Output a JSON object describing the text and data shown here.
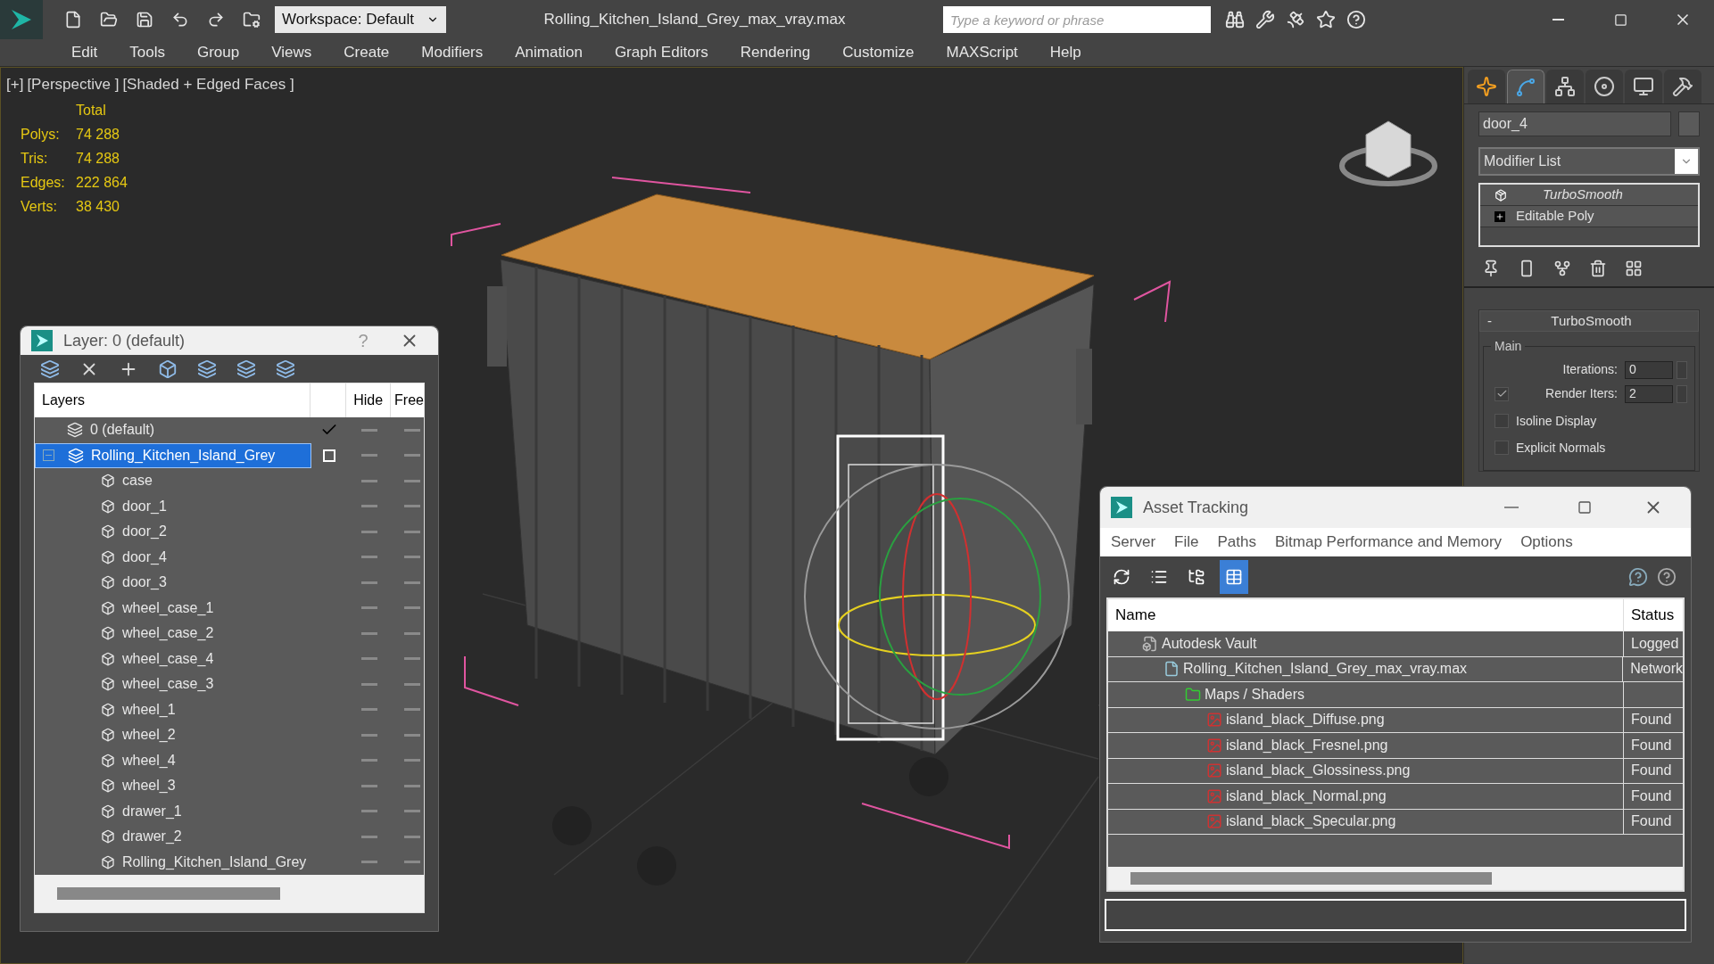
{
  "title_bar": {
    "title": "Rolling_Kitchen_Island_Grey_max_vray.max",
    "workspace": "Workspace: Default",
    "search": {
      "placeholder": "Type a keyword or phrase"
    }
  },
  "menu": [
    "Edit",
    "Tools",
    "Group",
    "Views",
    "Create",
    "Modifiers",
    "Animation",
    "Graph Editors",
    "Rendering",
    "Customize",
    "MAXScript",
    "Help"
  ],
  "viewport": {
    "labels": [
      "[+]",
      "[Perspective ]",
      "[Shaded + Edged Faces ]"
    ],
    "stats": {
      "header": "Total",
      "rows": [
        {
          "label": "Polys:",
          "value": "74 288"
        },
        {
          "label": "Tris:",
          "value": "74 288"
        },
        {
          "label": "Edges:",
          "value": "222 864"
        },
        {
          "label": "Verts:",
          "value": "38 430"
        }
      ]
    }
  },
  "layer_dialog": {
    "title": "Layer: 0 (default)",
    "help": "?",
    "columns": [
      "Layers",
      "Hide",
      "Free"
    ],
    "layers": [
      {
        "kind": "layer",
        "name": "0 (default)",
        "selected": false,
        "active": true
      },
      {
        "kind": "layer",
        "name": "Rolling_Kitchen_Island_Grey",
        "selected": true,
        "active": false,
        "expanded": true,
        "children": [
          {
            "kind": "object",
            "name": "case",
            "selected": false
          },
          {
            "kind": "object",
            "name": "door_1",
            "selected": false
          },
          {
            "kind": "object",
            "name": "door_2",
            "selected": false
          },
          {
            "kind": "object",
            "name": "door_4",
            "selected": false
          },
          {
            "kind": "object",
            "name": "door_3",
            "selected": false
          },
          {
            "kind": "object",
            "name": "wheel_case_1",
            "selected": false
          },
          {
            "kind": "object",
            "name": "wheel_case_2",
            "selected": false
          },
          {
            "kind": "object",
            "name": "wheel_case_4",
            "selected": false
          },
          {
            "kind": "object",
            "name": "wheel_case_3",
            "selected": false
          },
          {
            "kind": "object",
            "name": "wheel_1",
            "selected": false
          },
          {
            "kind": "object",
            "name": "wheel_2",
            "selected": false
          },
          {
            "kind": "object",
            "name": "wheel_4",
            "selected": false
          },
          {
            "kind": "object",
            "name": "wheel_3",
            "selected": false
          },
          {
            "kind": "object",
            "name": "drawer_1",
            "selected": false
          },
          {
            "kind": "object",
            "name": "drawer_2",
            "selected": false
          },
          {
            "kind": "object",
            "name": "Rolling_Kitchen_Island_Grey",
            "selected": false
          }
        ]
      }
    ]
  },
  "command_panel": {
    "tabs": [
      {
        "kind": "create",
        "selected": false
      },
      {
        "kind": "modify",
        "selected": true
      },
      {
        "kind": "hierarchy",
        "selected": false
      },
      {
        "kind": "motion",
        "selected": false
      },
      {
        "kind": "display",
        "selected": false
      },
      {
        "kind": "utilities",
        "selected": false
      }
    ],
    "object_name": "door_4",
    "modifier_list": "Modifier List",
    "stack": [
      {
        "kind": "modifier",
        "name": "TurboSmooth"
      },
      {
        "kind": "base",
        "name": "Editable Poly"
      }
    ],
    "rollout": {
      "title": "TurboSmooth",
      "collapse": "-",
      "group": "Main",
      "controls": [
        {
          "kind": "spinner",
          "label": "Iterations:",
          "value": "0"
        },
        {
          "kind": "check_spinner",
          "label": "Render Iters:",
          "value": "2",
          "checked": true
        },
        {
          "kind": "checkbox",
          "label": "Isoline Display",
          "checked": false
        },
        {
          "kind": "checkbox",
          "label": "Explicit Normals",
          "checked": false
        }
      ]
    }
  },
  "asset_tracking": {
    "title": "Asset Tracking",
    "menu": [
      "Server",
      "File",
      "Paths",
      "Bitmap Performance and Memory",
      "Options"
    ],
    "toolbar": [
      {
        "kind": "refresh",
        "selected": false
      },
      {
        "kind": "list",
        "selected": false
      },
      {
        "kind": "tree",
        "selected": false
      },
      {
        "kind": "table",
        "selected": true
      }
    ],
    "columns": [
      "Name",
      "Status"
    ],
    "rows": [
      {
        "kind": "vault",
        "name": "Autodesk Vault",
        "status": "Logged",
        "children": [
          {
            "kind": "max",
            "name": "Rolling_Kitchen_Island_Grey_max_vray.max",
            "status": "Network",
            "children": [
              {
                "kind": "folder",
                "name": "Maps / Shaders",
                "children": [
                  {
                    "kind": "png",
                    "name": "island_black_Diffuse.png",
                    "status": "Found"
                  },
                  {
                    "kind": "png",
                    "name": "island_black_Fresnel.png",
                    "status": "Found"
                  },
                  {
                    "kind": "png",
                    "name": "island_black_Glossiness.png",
                    "status": "Found"
                  },
                  {
                    "kind": "png",
                    "name": "island_black_Normal.png",
                    "status": "Found"
                  },
                  {
                    "kind": "png",
                    "name": "island_black_Specular.png",
                    "status": "Found"
                  }
                ]
              }
            ]
          }
        ]
      }
    ]
  }
}
